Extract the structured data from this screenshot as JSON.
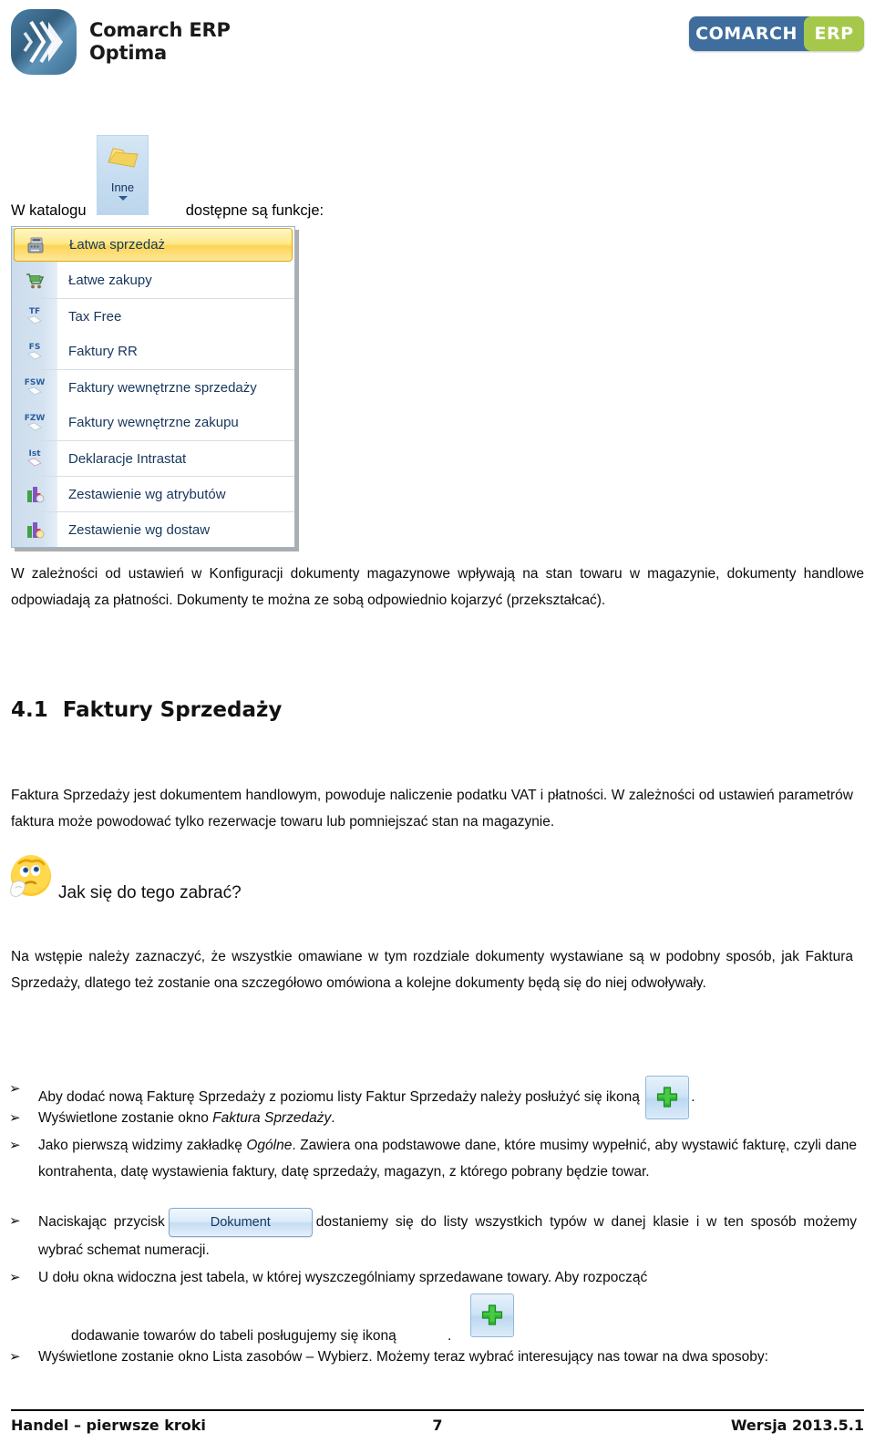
{
  "header": {
    "product_line1": "Comarch ERP",
    "product_line2": "Optima",
    "logo_comarch": "COMARCH",
    "logo_erp": "ERP",
    "brand_blue": "#3e6d9e",
    "brand_green": "#a5c84a"
  },
  "intro": {
    "before": "W katalogu",
    "after": "dostępne są funkcje:",
    "folder_button_label": "Inne"
  },
  "menu": {
    "items": [
      {
        "label": "Łatwa sprzedaż",
        "icon": "cash-register-icon",
        "selected": true,
        "separator_above": false
      },
      {
        "label": "Łatwe zakupy",
        "icon": "shopping-cart-icon",
        "selected": false,
        "separator_above": false
      },
      {
        "label": "Tax Free",
        "icon": "tf-document-icon",
        "selected": false,
        "separator_above": true
      },
      {
        "label": "Faktury RR",
        "icon": "fs-document-icon",
        "selected": false,
        "separator_above": false
      },
      {
        "label": "Faktury wewnętrzne sprzedaży",
        "icon": "fsw-document-icon",
        "selected": false,
        "separator_above": true
      },
      {
        "label": "Faktury wewnętrzne zakupu",
        "icon": "fzw-document-icon",
        "selected": false,
        "separator_above": false
      },
      {
        "label": "Deklaracje Intrastat",
        "icon": "ist-document-icon",
        "selected": false,
        "separator_above": true
      },
      {
        "label": "Zestawienie wg atrybutów",
        "icon": "bar-chart-icon",
        "selected": false,
        "separator_above": true
      },
      {
        "label": "Zestawienie wg dostaw",
        "icon": "bar-chart-icon",
        "selected": false,
        "separator_above": true
      }
    ]
  },
  "paragraphs": {
    "p1": "W zależności od ustawień w Konfiguracji dokumenty magazynowe wpływają na stan towaru w magazynie, dokumenty handlowe odpowiadają za płatności. Dokumenty te można ze sobą odpowiednio kojarzyć (przekształcać).",
    "p2": "Faktura Sprzedaży jest dokumentem handlowym, powoduje naliczenie podatku VAT i płatności. W zależności od ustawień parametrów faktura może powodować tylko rezerwacje towaru lub pomniejszać stan na magazynie.",
    "p3": "Na wstępie należy zaznaczyć, że wszystkie omawiane w tym rozdziale dokumenty wystawiane są w podobny sposób, jak Faktura Sprzedaży, dlatego też zostanie ona szczegółowo omówiona a kolejne dokumenty będą się do niej odwoływały."
  },
  "heading": {
    "number": "4.1",
    "title": "Faktury Sprzedaży"
  },
  "callout": {
    "icon": "thinking-face-icon",
    "text": "Jak się do tego zabrać?"
  },
  "bullets": {
    "marker": "➢",
    "b1_a": "Aby dodać nową Fakturę Sprzedaży z poziomu listy Faktur Sprzedaży należy posłużyć się ikoną",
    "b1_b": ".",
    "b2": "Wyświetlone zostanie okno ",
    "b2_it": "Faktura Sprzedaży",
    "b2_end": ".",
    "b3_a": "Jako pierwszą widzimy zakładkę ",
    "b3_it": "Ogólne",
    "b3_b": ". Zawiera ona podstawowe dane, które musimy wypełnić, aby wystawić fakturę, czyli dane kontrahenta, datę wystawienia faktury, datę sprzedaży, magazyn, z którego pobrany będzie towar.",
    "b4_a": "Naciskając przycisk",
    "b4_button": "Dokument",
    "b4_b": "dostaniemy się do listy wszystkich typów w danej klasie i w ten sposób możemy wybrać schemat numeracji.",
    "b5_a": "U dołu okna widoczna jest tabela, w której wyszczególniamy sprzedawane towary. Aby rozpocząć",
    "b5_b": "dodawanie towarów do tabeli posługujemy się ikoną",
    "b5_c": ".",
    "b6": "Wyświetlone zostanie okno Lista zasobów – Wybierz. Możemy teraz wybrać interesujący nas towar na dwa sposoby:"
  },
  "footer": {
    "left": "Handel – pierwsze kroki",
    "page": "7",
    "right": "Wersja 2013.5.1"
  }
}
